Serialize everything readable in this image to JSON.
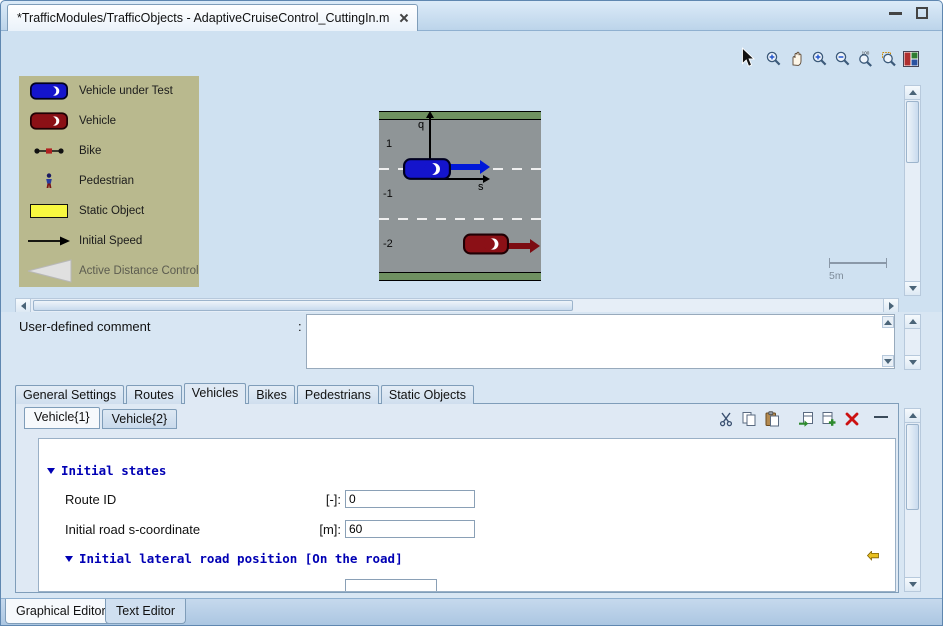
{
  "window": {
    "doc_tab_title": "*TrafficModules/TrafficObjects - AdaptiveCruiseControl_CuttingIn.m"
  },
  "toolbar": {
    "icons": [
      "mouse-cursor",
      "zoom-in",
      "pan-hand",
      "zoom-in",
      "zoom-out",
      "zoom-100",
      "zoom-region",
      "tile-windows"
    ]
  },
  "legend": {
    "items": [
      {
        "label": "Vehicle under Test"
      },
      {
        "label": "Vehicle"
      },
      {
        "label": "Bike"
      },
      {
        "label": "Pedestrian"
      },
      {
        "label": "Static Object"
      },
      {
        "label": "Initial Speed"
      },
      {
        "label": "Active Distance Control"
      }
    ]
  },
  "road_view": {
    "axis_vertical_label": "q",
    "axis_horizontal_label": "s",
    "lane_labels": [
      "1",
      "-1",
      "-2"
    ],
    "scale_label": "5m"
  },
  "comment": {
    "label": "User-defined comment",
    "separator": ":",
    "value": ""
  },
  "main_tabs": [
    {
      "label": "General Settings"
    },
    {
      "label": "Routes"
    },
    {
      "label": "Vehicles",
      "active": true
    },
    {
      "label": "Bikes"
    },
    {
      "label": "Pedestrians"
    },
    {
      "label": "Static Objects"
    }
  ],
  "vehicle_tabs": [
    {
      "label": "Vehicle{1}",
      "active": true
    },
    {
      "label": "Vehicle{2}"
    }
  ],
  "vehicle_toolbar": {
    "icons": [
      "cut",
      "copy",
      "paste",
      "import-row",
      "add-row",
      "delete"
    ]
  },
  "form": {
    "section_initial_states": "Initial states",
    "rows": [
      {
        "label": "Route ID",
        "unit": "[-]:",
        "value": "0"
      },
      {
        "label": "Initial road s-coordinate",
        "unit": "[m]:",
        "value": "60"
      }
    ],
    "section_lateral": "Initial lateral road position [On the road]"
  },
  "bottom_tabs": [
    {
      "label": "Graphical Editor",
      "active": true
    },
    {
      "label": "Text Editor"
    }
  ],
  "colors": {
    "vut_blue": "#1414cc",
    "vehicle_red": "#8b1016",
    "legend_bg": "#b9b98e",
    "section_header_blue": "#0000b4"
  }
}
